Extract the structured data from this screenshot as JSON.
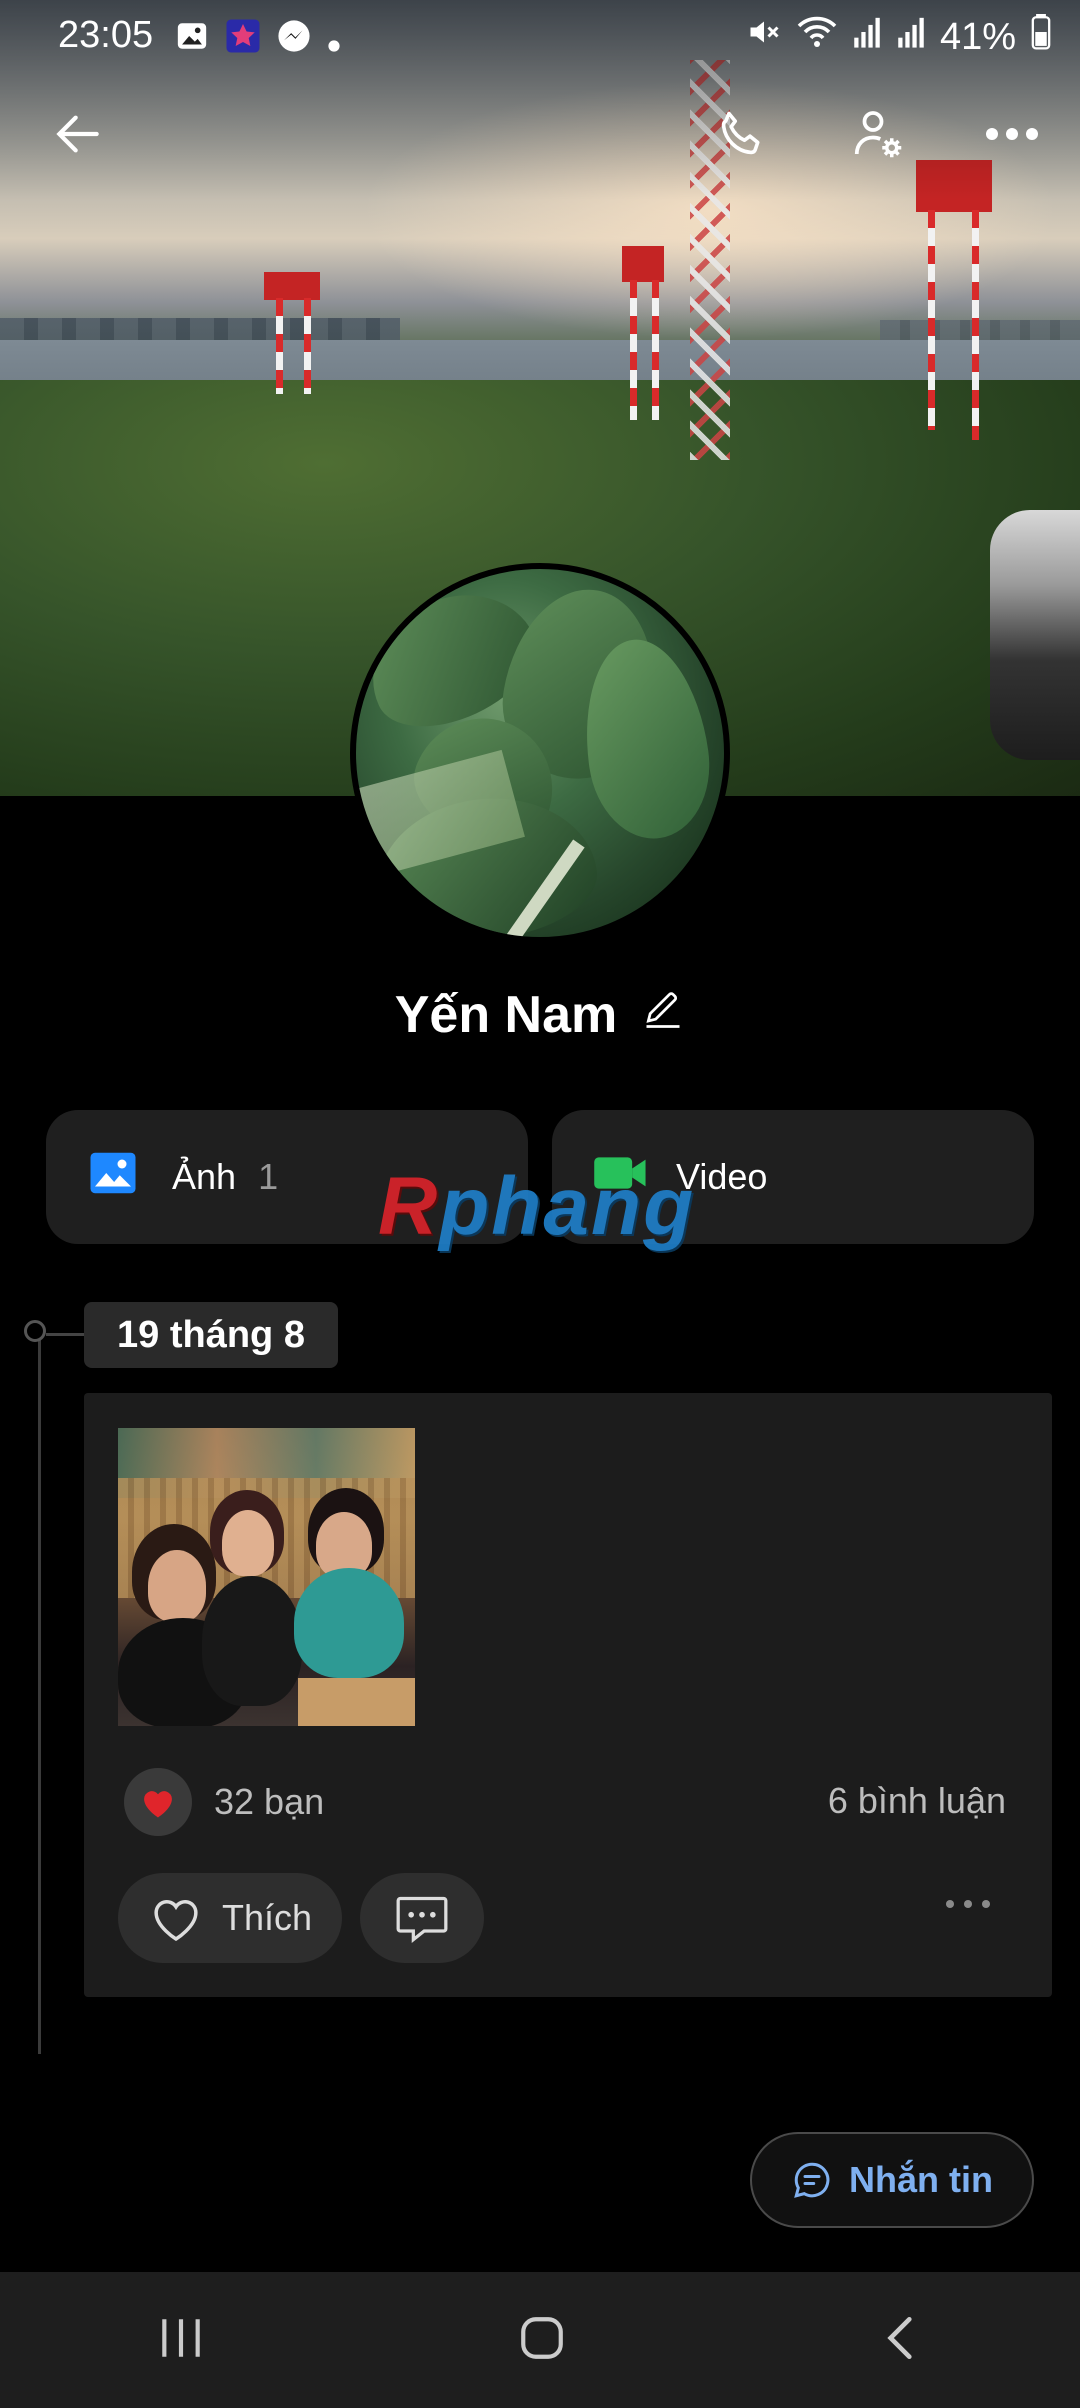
{
  "status_bar": {
    "time": "23:05",
    "battery": "41%",
    "notification_icons": [
      "image-icon",
      "star-app-icon",
      "messenger-icon",
      "dot-icon"
    ],
    "system_icons": [
      "mute-icon",
      "wifi-icon",
      "signal-icon",
      "signal-icon",
      "battery-icon"
    ]
  },
  "header": {
    "back_icon": "arrow-left-icon",
    "call_icon": "phone-icon",
    "profile_settings_icon": "user-gear-icon",
    "more_icon": "more-horizontal-icon"
  },
  "profile": {
    "name": "Yến Nam",
    "edit_icon": "pencil-icon"
  },
  "media": {
    "photos_label": "Ảnh",
    "photos_count": "1",
    "video_label": "Video"
  },
  "watermark": {
    "brand_red": "R",
    "brand_rest": "phang"
  },
  "timeline": {
    "date": "19 tháng 8",
    "post": {
      "reaction_icon": "heart-icon",
      "likes_text": "32 bạn",
      "comments_text": "6 bình luận",
      "like_label": "Thích",
      "comment_icon": "comment-icon",
      "more_icon": "more-horizontal-icon"
    }
  },
  "actions": {
    "message_label": "Nhắn tin"
  },
  "colors": {
    "background": "#000000",
    "surface": "#1c1c1c",
    "accent_blue": "#7fb0f0",
    "photo_icon_blue": "#1e88ff",
    "video_icon_green": "#27c15b",
    "heart_red": "#e0252b"
  }
}
